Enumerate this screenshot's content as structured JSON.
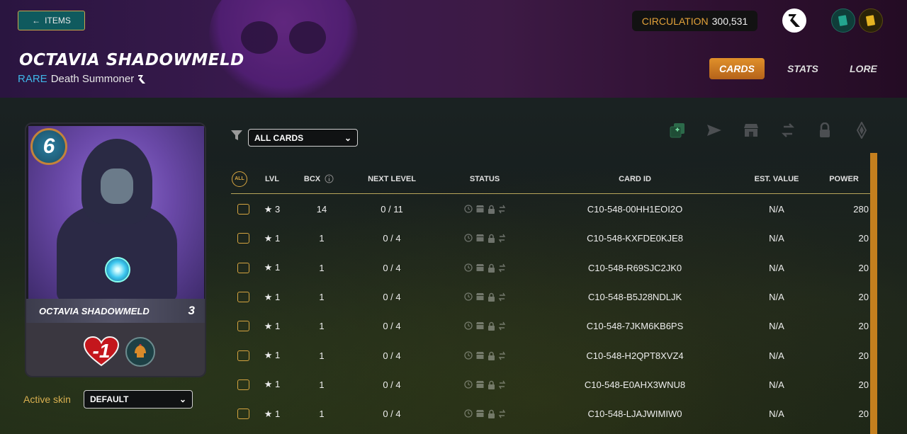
{
  "header": {
    "back_label": "ITEMS",
    "title": "OCTAVIA SHADOWMELD",
    "rarity": "RARE",
    "type": "Death Summoner",
    "circulation_label": "CIRCULATION",
    "circulation_value": "300,531",
    "tabs": [
      {
        "label": "CARDS",
        "active": true
      },
      {
        "label": "STATS",
        "active": false
      },
      {
        "label": "LORE",
        "active": false
      }
    ]
  },
  "card": {
    "mana": "6",
    "name": "OCTAVIA SHADOWMELD",
    "level": "3",
    "health": "-1"
  },
  "skin": {
    "label": "Active skin",
    "value": "DEFAULT"
  },
  "filter": {
    "value": "ALL CARDS"
  },
  "table": {
    "all_label": "ALL",
    "headers": {
      "lvl": "LVL",
      "bcx": "BCX",
      "next_level": "NEXT LEVEL",
      "status": "STATUS",
      "card_id": "CARD ID",
      "est_value": "EST. VALUE",
      "power": "POWER"
    },
    "rows": [
      {
        "lvl": "★ 3",
        "bcx": "14",
        "next": "0 / 11",
        "id": "C10-548-00HH1EOI2O",
        "value": "N/A",
        "power": "280"
      },
      {
        "lvl": "★ 1",
        "bcx": "1",
        "next": "0 / 4",
        "id": "C10-548-KXFDE0KJE8",
        "value": "N/A",
        "power": "20"
      },
      {
        "lvl": "★ 1",
        "bcx": "1",
        "next": "0 / 4",
        "id": "C10-548-R69SJC2JK0",
        "value": "N/A",
        "power": "20"
      },
      {
        "lvl": "★ 1",
        "bcx": "1",
        "next": "0 / 4",
        "id": "C10-548-B5J28NDLJK",
        "value": "N/A",
        "power": "20"
      },
      {
        "lvl": "★ 1",
        "bcx": "1",
        "next": "0 / 4",
        "id": "C10-548-7JKM6KB6PS",
        "value": "N/A",
        "power": "20"
      },
      {
        "lvl": "★ 1",
        "bcx": "1",
        "next": "0 / 4",
        "id": "C10-548-H2QPT8XVZ4",
        "value": "N/A",
        "power": "20"
      },
      {
        "lvl": "★ 1",
        "bcx": "1",
        "next": "0 / 4",
        "id": "C10-548-E0AHX3WNU8",
        "value": "N/A",
        "power": "20"
      },
      {
        "lvl": "★ 1",
        "bcx": "1",
        "next": "0 / 4",
        "id": "C10-548-LJAJWIMIW0",
        "value": "N/A",
        "power": "20"
      }
    ]
  },
  "colors": {
    "accent": "#c47f1e",
    "rarity": "#3fb6e8",
    "checkbox": "#d5a440"
  }
}
